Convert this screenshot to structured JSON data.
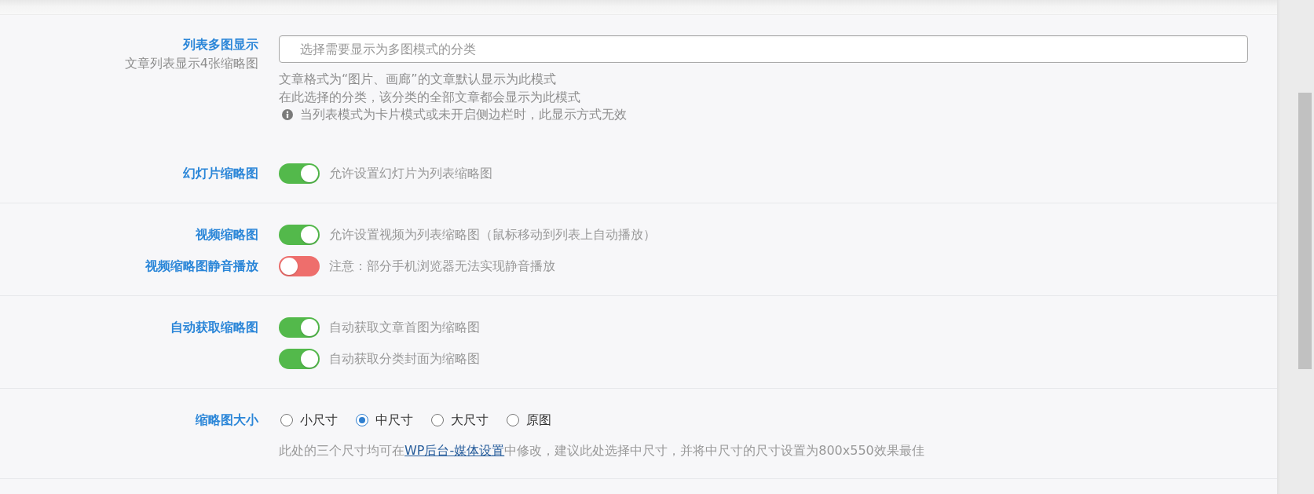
{
  "sections": [
    {
      "rows": [
        {
          "kind": "select",
          "label": "列表多图显示",
          "sublabel": "文章列表显示4张缩略图",
          "placeholder": "选择需要显示为多图模式的分类",
          "notes": [
            {
              "kind": "plain",
              "text": "文章格式为“图片、画廊”的文章默认显示为此模式"
            },
            {
              "kind": "plain",
              "text": "在此选择的分类，该分类的全部文章都会显示为此模式"
            },
            {
              "kind": "info",
              "text": "当列表模式为卡片模式或未开启侧边栏时，此显示方式无效"
            }
          ]
        },
        {
          "kind": "toggle",
          "label": "幻灯片缩略图",
          "on": true,
          "description": "允许设置幻灯片为列表缩略图"
        }
      ]
    },
    {
      "rows": [
        {
          "kind": "toggle",
          "label": "视频缩略图",
          "on": true,
          "description": "允许设置视频为列表缩略图（鼠标移动到列表上自动播放）"
        },
        {
          "kind": "toggle",
          "label": "视频缩略图静音播放",
          "on": false,
          "description": "注意：部分手机浏览器无法实现静音播放"
        }
      ]
    },
    {
      "rows": [
        {
          "kind": "toggle",
          "label": "自动获取缩略图",
          "on": true,
          "description": "自动获取文章首图为缩略图"
        },
        {
          "kind": "toggle",
          "on": true,
          "description": "自动获取分类封面为缩略图"
        }
      ]
    },
    {
      "rows": [
        {
          "kind": "radio",
          "label": "缩略图大小",
          "options": [
            {
              "label": "小尺寸",
              "selected": false
            },
            {
              "label": "中尺寸",
              "selected": true
            },
            {
              "label": "大尺寸",
              "selected": false
            },
            {
              "label": "原图",
              "selected": false
            }
          ],
          "note": [
            {
              "kind": "text",
              "text": "此处的三个尺寸均可在"
            },
            {
              "kind": "link",
              "text": "WP后台-媒体设置"
            },
            {
              "kind": "text",
              "text": "中修改，建议此处选择中尺寸，并将中尺寸的尺寸设置为800x550效果最佳"
            }
          ]
        }
      ]
    }
  ]
}
